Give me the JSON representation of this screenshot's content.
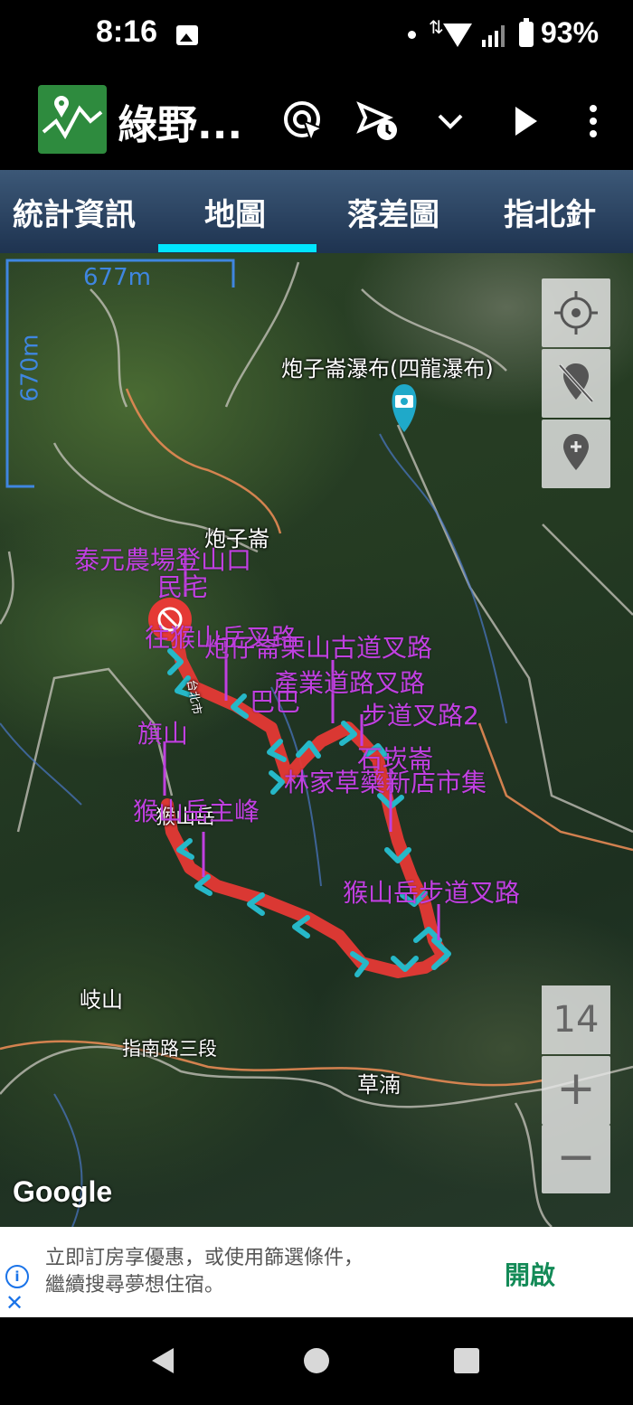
{
  "status_bar": {
    "time": "8:16",
    "battery": "93%"
  },
  "app": {
    "title": "綠野..."
  },
  "tabs": [
    {
      "label": "統計資訊"
    },
    {
      "label": "地圖"
    },
    {
      "label": "落差圖"
    },
    {
      "label": "指北針"
    }
  ],
  "active_tab": "地圖",
  "map": {
    "scale": {
      "horizontal": "677m",
      "vertical": "670m"
    },
    "zoom_level": "14",
    "zoom_in": "+",
    "zoom_out": "−",
    "attribution": "Google",
    "places": {
      "waterfall": "炮子崙瀑布(四龍瀑布)",
      "paozilun": "炮子崙",
      "qishan_west": "岐山",
      "zhinan_road": "指南路三段",
      "caonan": "草湳",
      "houshanyue_base": "猴山岳",
      "road_tai": "台北市"
    },
    "waypoints": {
      "taiyuan_farm": "泰元農場登山口",
      "minzhai": "民宅",
      "to_houshanyue_fork": "往猴山岳叉路",
      "paozi_trail": "炮仔崙栗山古道叉路",
      "trail_fork_cluster": "產業道路叉路",
      "baba_fork": "巴巴",
      "fork2": "步道叉路2",
      "shihanlun": "石崁崙",
      "linjia": "林家草藥新店市集",
      "qishan": "旗山",
      "main_peak": "猴山岳主峰",
      "trail_fork": "猴山岳步道叉路"
    }
  },
  "ad": {
    "line1": "立即訂房享優惠，或使用篩選條件，",
    "line2": "繼續搜尋夢想住宿。",
    "button": "開啟",
    "info": "i",
    "close": "✕"
  },
  "colors": {
    "tab_indicator": "#00e5ff",
    "track": "#e53935",
    "arrows": "#26b8c8",
    "waypoint": "#c040e0",
    "scale": "#3f86e0",
    "ad_button": "#138a57"
  }
}
